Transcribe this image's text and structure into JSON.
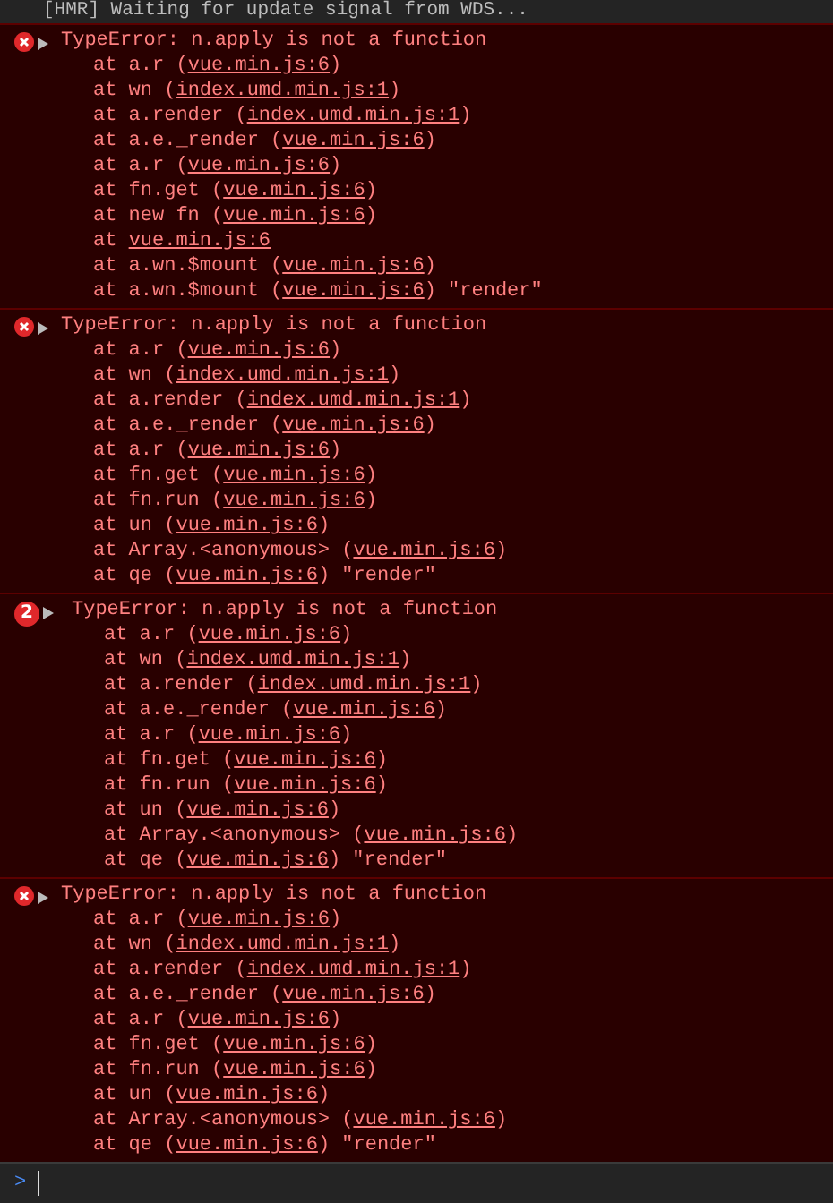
{
  "log_line": "[HMR] Waiting for update signal from WDS...",
  "messages": [
    {
      "kind": "error",
      "title": "TypeError: n.apply is not a function",
      "frames": [
        {
          "text": "at a.r (",
          "link": "vue.min.js:6",
          "tail": ")"
        },
        {
          "text": "at wn (",
          "link": "index.umd.min.js:1",
          "tail": ")"
        },
        {
          "text": "at a.render (",
          "link": "index.umd.min.js:1",
          "tail": ")"
        },
        {
          "text": "at a.e._render (",
          "link": "vue.min.js:6",
          "tail": ")"
        },
        {
          "text": "at a.r (",
          "link": "vue.min.js:6",
          "tail": ")"
        },
        {
          "text": "at fn.get (",
          "link": "vue.min.js:6",
          "tail": ")"
        },
        {
          "text": "at new fn (",
          "link": "vue.min.js:6",
          "tail": ")"
        },
        {
          "text": "at ",
          "link": "vue.min.js:6"
        },
        {
          "text": "at a.wn.$mount (",
          "link": "vue.min.js:6",
          "tail": ")"
        },
        {
          "text": "at a.wn.$mount (",
          "link": "vue.min.js:6",
          "tail": ") \"render\""
        }
      ]
    },
    {
      "kind": "error",
      "title": "TypeError: n.apply is not a function",
      "frames": [
        {
          "text": "at a.r (",
          "link": "vue.min.js:6",
          "tail": ")"
        },
        {
          "text": "at wn (",
          "link": "index.umd.min.js:1",
          "tail": ")"
        },
        {
          "text": "at a.render (",
          "link": "index.umd.min.js:1",
          "tail": ")"
        },
        {
          "text": "at a.e._render (",
          "link": "vue.min.js:6",
          "tail": ")"
        },
        {
          "text": "at a.r (",
          "link": "vue.min.js:6",
          "tail": ")"
        },
        {
          "text": "at fn.get (",
          "link": "vue.min.js:6",
          "tail": ")"
        },
        {
          "text": "at fn.run (",
          "link": "vue.min.js:6",
          "tail": ")"
        },
        {
          "text": "at un (",
          "link": "vue.min.js:6",
          "tail": ")"
        },
        {
          "text": "at Array.<anonymous> (",
          "link": "vue.min.js:6",
          "tail": ")"
        },
        {
          "text": "at qe (",
          "link": "vue.min.js:6",
          "tail": ") \"render\""
        }
      ]
    },
    {
      "kind": "repeat",
      "count": "2",
      "title": "TypeError: n.apply is not a function",
      "frames": [
        {
          "text": "at a.r (",
          "link": "vue.min.js:6",
          "tail": ")"
        },
        {
          "text": "at wn (",
          "link": "index.umd.min.js:1",
          "tail": ")"
        },
        {
          "text": "at a.render (",
          "link": "index.umd.min.js:1",
          "tail": ")"
        },
        {
          "text": "at a.e._render (",
          "link": "vue.min.js:6",
          "tail": ")"
        },
        {
          "text": "at a.r (",
          "link": "vue.min.js:6",
          "tail": ")"
        },
        {
          "text": "at fn.get (",
          "link": "vue.min.js:6",
          "tail": ")"
        },
        {
          "text": "at fn.run (",
          "link": "vue.min.js:6",
          "tail": ")"
        },
        {
          "text": "at un (",
          "link": "vue.min.js:6",
          "tail": ")"
        },
        {
          "text": "at Array.<anonymous> (",
          "link": "vue.min.js:6",
          "tail": ")"
        },
        {
          "text": "at qe (",
          "link": "vue.min.js:6",
          "tail": ") \"render\""
        }
      ]
    },
    {
      "kind": "error",
      "title": "TypeError: n.apply is not a function",
      "frames": [
        {
          "text": "at a.r (",
          "link": "vue.min.js:6",
          "tail": ")"
        },
        {
          "text": "at wn (",
          "link": "index.umd.min.js:1",
          "tail": ")"
        },
        {
          "text": "at a.render (",
          "link": "index.umd.min.js:1",
          "tail": ")"
        },
        {
          "text": "at a.e._render (",
          "link": "vue.min.js:6",
          "tail": ")"
        },
        {
          "text": "at a.r (",
          "link": "vue.min.js:6",
          "tail": ")"
        },
        {
          "text": "at fn.get (",
          "link": "vue.min.js:6",
          "tail": ")"
        },
        {
          "text": "at fn.run (",
          "link": "vue.min.js:6",
          "tail": ")"
        },
        {
          "text": "at un (",
          "link": "vue.min.js:6",
          "tail": ")"
        },
        {
          "text": "at Array.<anonymous> (",
          "link": "vue.min.js:6",
          "tail": ")"
        },
        {
          "text": "at qe (",
          "link": "vue.min.js:6",
          "tail": ") \"render\""
        }
      ]
    }
  ],
  "prompt": {
    "symbol": ">"
  }
}
